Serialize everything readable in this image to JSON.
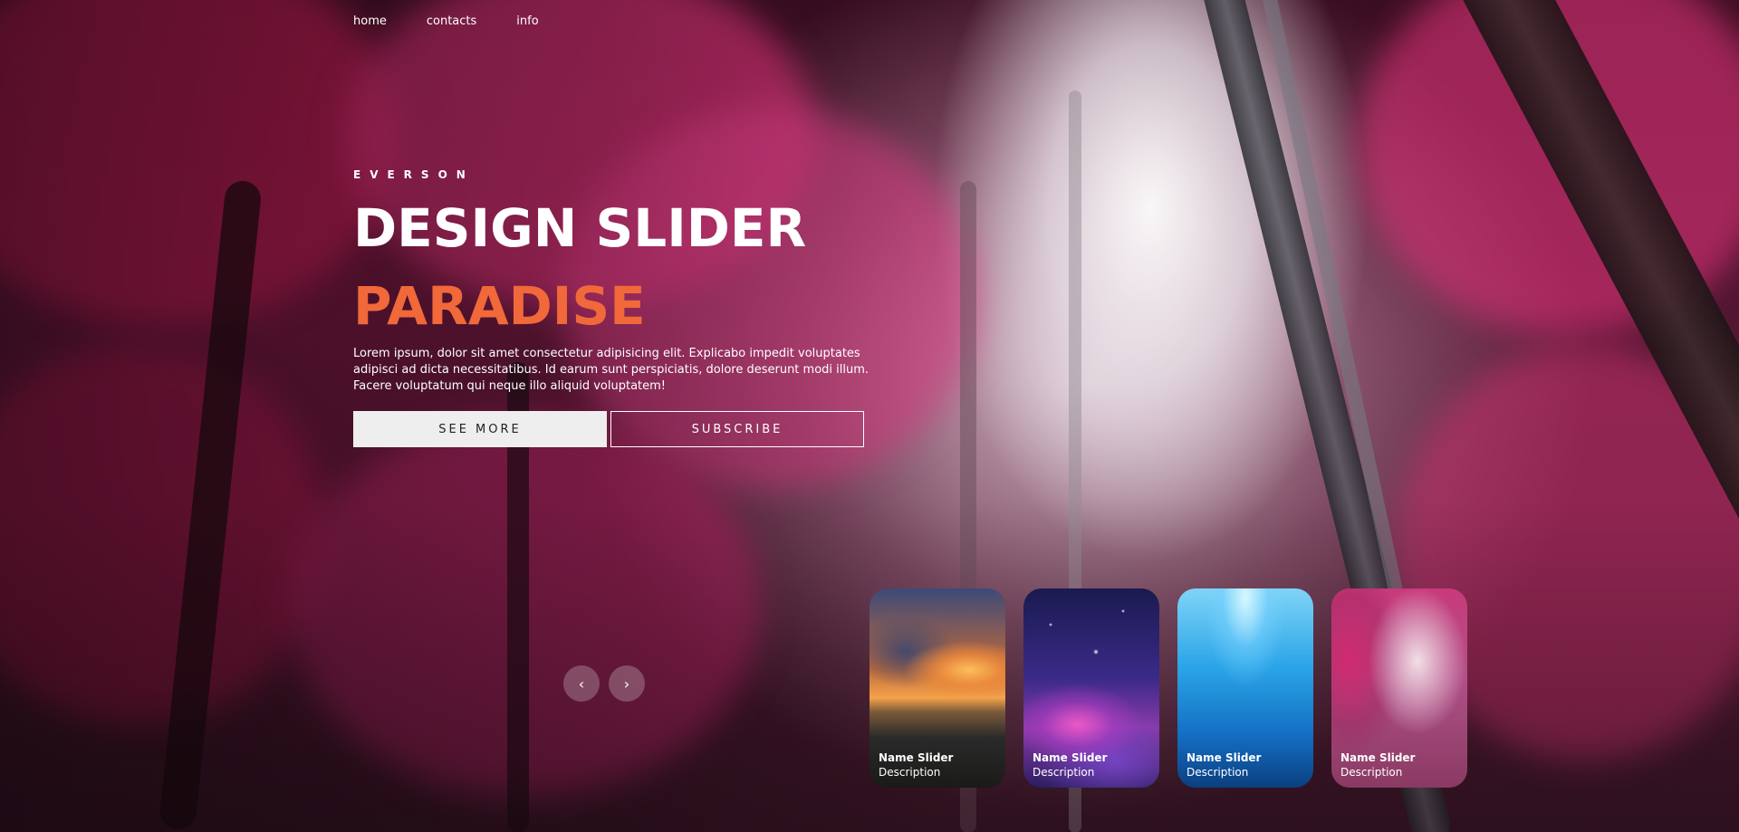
{
  "nav": {
    "items": [
      {
        "label": "home"
      },
      {
        "label": "contacts"
      },
      {
        "label": "info"
      }
    ]
  },
  "hero": {
    "author": "EVERSON",
    "title": "DESIGN SLIDER",
    "topic": "PARADISE",
    "description": "Lorem ipsum, dolor sit amet consectetur adipisicing elit. Explicabo impedit voluptates adipisci ad dicta necessitatibus. Id earum sunt perspiciatis, dolore deserunt modi illum. Facere voluptatum qui neque illo aliquid voluptatem!",
    "see_more_label": "SEE MORE",
    "subscribe_label": "SUBSCRIBE"
  },
  "thumbnails": [
    {
      "title": "Name Slider",
      "description": "Description",
      "scene": "sunset-lake"
    },
    {
      "title": "Name Slider",
      "description": "Description",
      "scene": "purple-galaxy"
    },
    {
      "title": "Name Slider",
      "description": "Description",
      "scene": "underwater"
    },
    {
      "title": "Name Slider",
      "description": "Description",
      "scene": "pink-forest"
    }
  ],
  "arrows": {
    "prev_icon": "chevron-left-icon",
    "prev_label": "‹",
    "next_icon": "chevron-right-icon",
    "next_label": "›"
  },
  "colors": {
    "accent": "#f1683a",
    "button_bg": "#eeeeee",
    "text": "#ffffff"
  }
}
